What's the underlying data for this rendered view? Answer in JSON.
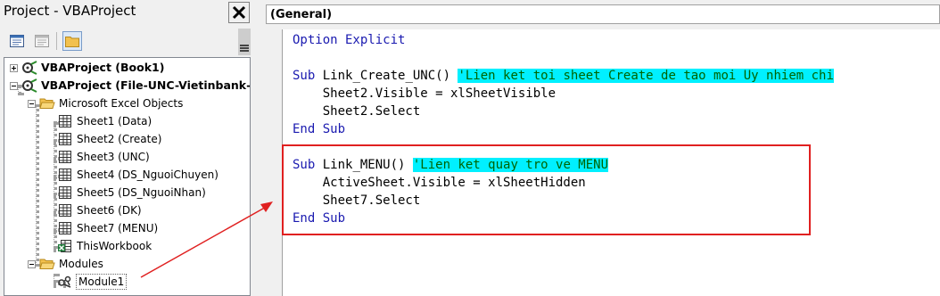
{
  "project_pane": {
    "title": "Project - VBAProject",
    "toolbar": {
      "view_code": "view-code-icon",
      "view_object": "view-object-icon",
      "toggle_folders": "folder-icon"
    },
    "tree": {
      "project1": "VBAProject (Book1)",
      "project2": "VBAProject (File-UNC-Vietinbank-DI",
      "excel_objects_folder": "Microsoft Excel Objects",
      "sheets": [
        "Sheet1 (Data)",
        "Sheet2 (Create)",
        "Sheet3 (UNC)",
        "Sheet4 (DS_NguoiChuyen)",
        "Sheet5 (DS_NguoiNhan)",
        "Sheet6 (DK)",
        "Sheet7 (MENU)"
      ],
      "workbook": "ThisWorkbook",
      "modules_folder": "Modules",
      "module1": "Module1"
    }
  },
  "code_window": {
    "object_dropdown": "(General)",
    "lines": {
      "l1": {
        "kw": "Option Explicit"
      },
      "l2": {
        "kw": "Sub",
        "name": " Link_Create_UNC() ",
        "comment": "'Lien ket toi sheet Create de tao moi Uy nhiem chi"
      },
      "l3": {
        "text": "    Sheet2.Visible = xlSheetVisible"
      },
      "l4": {
        "text": "    Sheet2.Select"
      },
      "l5": {
        "kw": "End Sub"
      },
      "l6": {
        "kw": "Sub",
        "name": " Link_MENU() ",
        "comment": "'Lien ket quay tro ve MENU"
      },
      "l7": {
        "text": "    ActiveSheet.Visible = xlSheetHidden"
      },
      "l8": {
        "text": "    Sheet7.Select"
      },
      "l9": {
        "kw": "End Sub"
      }
    }
  },
  "annotation_color": "#e02020",
  "comment_highlight_color": "#00f0ff"
}
